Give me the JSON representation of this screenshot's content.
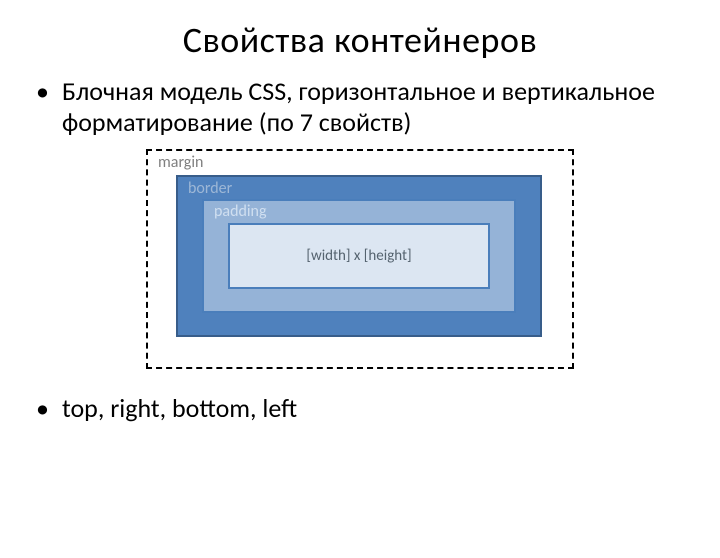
{
  "title": "Свойства контейнеров",
  "bullet1": "Блочная модель CSS, горизонтальное и вертикальное форматирование (по 7 свойств)",
  "bullet2": "top, right, bottom, left",
  "box": {
    "margin": "margin",
    "border": "border",
    "padding": "padding",
    "content": "[width] x [height]"
  }
}
